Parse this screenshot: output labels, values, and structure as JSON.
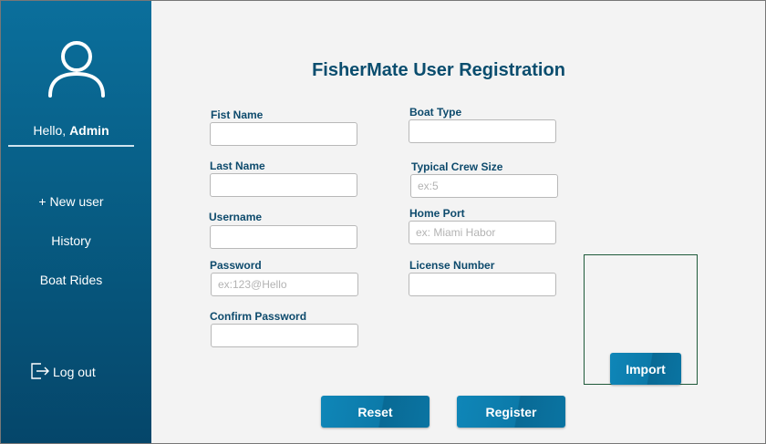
{
  "sidebar": {
    "greeting_prefix": "Hello,",
    "user_name": "Admin",
    "items": [
      {
        "label": "+ New user"
      },
      {
        "label": "History"
      },
      {
        "label": "Boat Rides"
      }
    ],
    "logout_label": "Log out"
  },
  "form": {
    "title": "FisherMate User Registration",
    "first_name": {
      "label": "Fist Name",
      "value": "",
      "placeholder": ""
    },
    "last_name": {
      "label": "Last Name",
      "value": "",
      "placeholder": ""
    },
    "username": {
      "label": "Username",
      "value": "",
      "placeholder": ""
    },
    "password": {
      "label": "Password",
      "value": "",
      "placeholder": "ex:123@Hello"
    },
    "confirm_password": {
      "label": "Confirm Password",
      "value": "",
      "placeholder": ""
    },
    "boat_type": {
      "label": "Boat Type",
      "value": "",
      "placeholder": ""
    },
    "crew_size": {
      "label": "Typical Crew Size",
      "value": "",
      "placeholder": "ex:5"
    },
    "home_port": {
      "label": "Home Port",
      "value": "",
      "placeholder": "ex: Miami Habor"
    },
    "license_number": {
      "label": "License Number",
      "value": "",
      "placeholder": ""
    }
  },
  "buttons": {
    "import": "Import",
    "reset": "Reset",
    "register": "Register"
  },
  "colors": {
    "sidebar_top": "#0b6f9c",
    "sidebar_bottom": "#05466a",
    "accent": "#0c7aa9",
    "label": "#0d4a6c"
  },
  "icons": {
    "avatar": "user-icon",
    "logout": "logout-icon"
  }
}
